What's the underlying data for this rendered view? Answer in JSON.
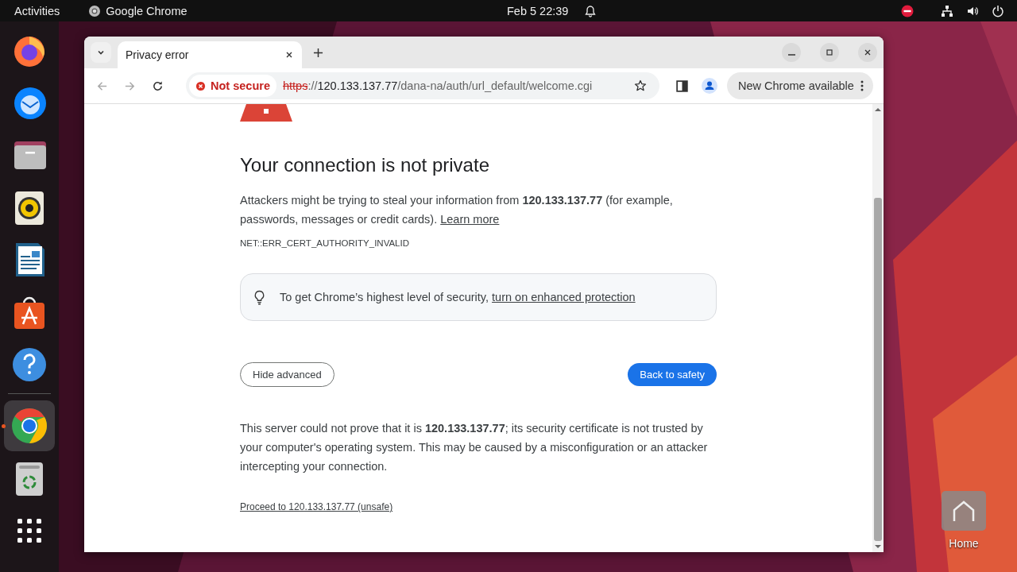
{
  "top_bar": {
    "activities": "Activities",
    "app_name": "Google Chrome",
    "clock": "Feb 5  22:39"
  },
  "dock": {
    "items": [
      {
        "kind": "firefox",
        "active": false
      },
      {
        "kind": "mail",
        "active": false
      },
      {
        "kind": "files",
        "active": false
      },
      {
        "kind": "music",
        "active": false
      },
      {
        "kind": "writer",
        "active": false
      },
      {
        "kind": "store",
        "active": false
      },
      {
        "kind": "help",
        "active": false
      }
    ],
    "lower_items": [
      {
        "kind": "chrome",
        "active": true
      },
      {
        "kind": "trash",
        "active": false
      },
      {
        "kind": "apps",
        "active": false
      }
    ]
  },
  "desktop": {
    "icons": [
      {
        "label": "Home"
      }
    ]
  },
  "browser": {
    "tabs": [
      {
        "title": "Privacy error",
        "selected": true
      }
    ],
    "address": {
      "security_label": "Not secure",
      "scheme": "https",
      "separator": "://",
      "host": "120.133.137.77",
      "path": "/dana-na/auth/url_default/welcome.cgi"
    },
    "update_button": "New Chrome available"
  },
  "page": {
    "heading": "Your connection is not private",
    "intro": "Attackers might be trying to steal your information from **120.133.137.77** (for example, passwords, messages or credit cards).",
    "learn_more": "Learn more",
    "error_code": "NET::ERR_CERT_AUTHORITY_INVALID",
    "tip": "To get Chrome’s highest level of security,",
    "tip_link": "turn on enhanced protection",
    "hide_button": "Hide advanced",
    "back_button": "Back to safety",
    "details": "This server could not prove that it is **120.133.137.77**; its security certificate is not trusted by your computer's operating system. This may be caused by a misconfiguration or an attacker intercepting your connection.",
    "proceed_link": "Proceed to 120.133.137.77 (unsafe)"
  }
}
